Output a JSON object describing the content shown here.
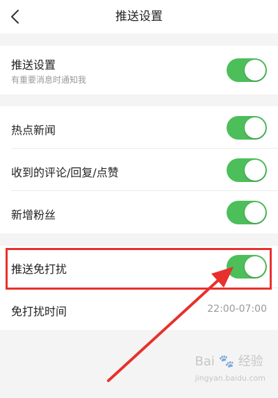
{
  "header": {
    "title": "推送设置",
    "back_icon": "chevron-left-icon"
  },
  "push_group": {
    "push_settings": {
      "label": "推送设置",
      "subtitle": "有重要消息时通知我",
      "enabled": true
    }
  },
  "notification_group": {
    "hot_news": {
      "label": "热点新闻",
      "enabled": true
    },
    "comments": {
      "label": "收到的评论/回复/点赞",
      "enabled": true
    },
    "new_fans": {
      "label": "新增粉丝",
      "enabled": true
    }
  },
  "dnd_group": {
    "do_not_disturb": {
      "label": "推送免打扰",
      "enabled": true
    },
    "dnd_time": {
      "label": "免打扰时间",
      "value": "22:00-07:00"
    }
  },
  "annotation": {
    "highlight_color": "#e8302c",
    "arrow_color": "#e8302c"
  },
  "watermark": {
    "text": "Bai",
    "suffix": "经验",
    "url": "jingyan.baidu.com"
  },
  "colors": {
    "toggle_on": "#4cbe5a",
    "background": "#f4f4f4",
    "row_background": "#ffffff"
  }
}
